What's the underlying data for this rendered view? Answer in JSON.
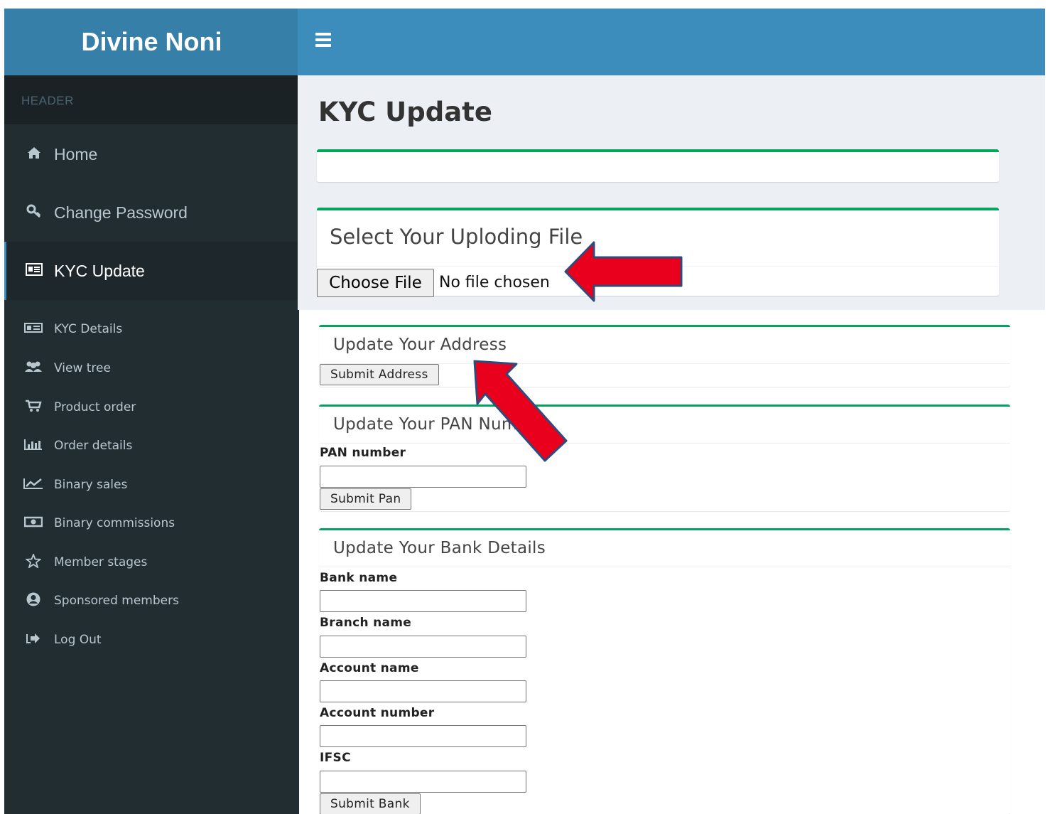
{
  "app": {
    "brand": "Divine Noni"
  },
  "sidebar": {
    "header": "HEADER",
    "main_items": [
      {
        "label": "Home",
        "icon": "home-icon"
      },
      {
        "label": "Change Password",
        "icon": "key-icon"
      },
      {
        "label": "KYC Update",
        "icon": "id-card-icon",
        "active": true
      }
    ],
    "sub_items": [
      {
        "label": "KYC Details",
        "icon": "id-card-icon"
      },
      {
        "label": "View tree",
        "icon": "users-icon"
      },
      {
        "label": "Product order",
        "icon": "cart-icon"
      },
      {
        "label": "Order details",
        "icon": "bar-chart-icon"
      },
      {
        "label": "Binary sales",
        "icon": "line-chart-icon"
      },
      {
        "label": "Binary commissions",
        "icon": "money-icon"
      },
      {
        "label": "Member stages",
        "icon": "star-icon"
      },
      {
        "label": "Sponsored members",
        "icon": "user-circle-icon"
      },
      {
        "label": "Log Out",
        "icon": "sign-out-icon"
      }
    ]
  },
  "main": {
    "title": "KYC Update",
    "upload": {
      "title": "Select Your Uploding File",
      "button": "Choose File",
      "status": "No file chosen"
    },
    "address": {
      "title": "Update Your Address",
      "button": "Submit Address"
    },
    "pan": {
      "title": "Update Your PAN Number",
      "label": "PAN number",
      "value": "",
      "button": "Submit Pan"
    },
    "bank": {
      "title": "Update Your Bank Details",
      "fields": [
        {
          "label": "Bank name",
          "value": ""
        },
        {
          "label": "Branch name",
          "value": ""
        },
        {
          "label": "Account name",
          "value": ""
        },
        {
          "label": "Account number",
          "value": ""
        },
        {
          "label": "IFSC",
          "value": ""
        }
      ],
      "button": "Submit Bank"
    }
  },
  "colors": {
    "brand_bar": "#367fa9",
    "nav_bar": "#3c8dbc",
    "sidebar": "#222d32",
    "accent_green": "#00a65a",
    "annotation_arrow": "#e8001c"
  }
}
